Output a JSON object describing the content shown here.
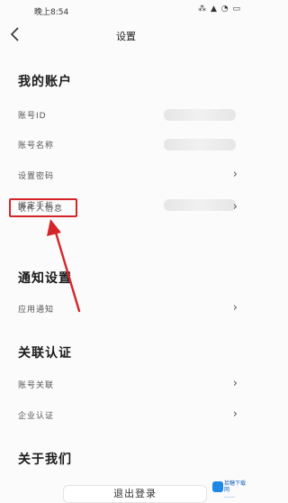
{
  "status": {
    "time": "晚上8:54",
    "icons": "⁂ ▲ ◔ ▭"
  },
  "nav": {
    "title": "设置"
  },
  "sections": {
    "account": "我的账户",
    "notify": "通知设置",
    "linked": "关联认证",
    "about": "关于我们"
  },
  "rows": {
    "account_id": "账号ID",
    "account_name": "账号名称",
    "set_password": "设置密码",
    "bind_phone": "绑定手机",
    "recipient_info": "收件人信息",
    "app_notify": "应用通知",
    "account_link": "账号关联",
    "enterprise_auth": "企业认证"
  },
  "logout": "退出登录",
  "watermark": {
    "line1": "拾糖下载网",
    "line2": "……"
  },
  "colors": {
    "highlight": "#d4262a"
  }
}
